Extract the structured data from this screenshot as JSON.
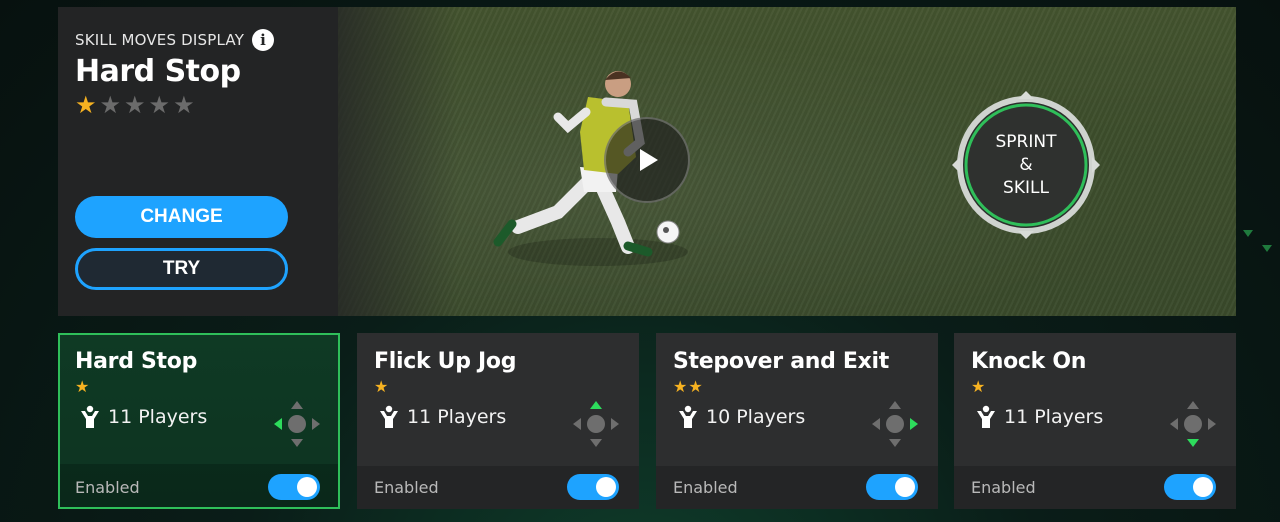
{
  "display": {
    "section_label": "SKILL MOVES DISPLAY",
    "title": "Hard Stop",
    "rating": 1,
    "max_rating": 5,
    "change_label": "CHANGE",
    "try_label": "TRY",
    "sprint_lines": [
      "SPRINT",
      "&",
      "SKILL"
    ]
  },
  "cards": [
    {
      "name": "Hard Stop",
      "stars": "★",
      "players": "11 Players",
      "direction": "left",
      "status": "Enabled",
      "enabled": true,
      "selected": true
    },
    {
      "name": "Flick Up Jog",
      "stars": "★",
      "players": "11 Players",
      "direction": "up",
      "status": "Enabled",
      "enabled": true,
      "selected": false
    },
    {
      "name": "Stepover and Exit",
      "stars": "★★",
      "players": "10 Players",
      "direction": "right",
      "status": "Enabled",
      "enabled": true,
      "selected": false
    },
    {
      "name": "Knock On",
      "stars": "★",
      "players": "11 Players",
      "direction": "down",
      "status": "Enabled",
      "enabled": true,
      "selected": false
    }
  ],
  "colors": {
    "accent_blue": "#1ea3ff",
    "selected_green": "#2fbf5a",
    "star_gold": "#f6b221",
    "direction_green": "#2ddc5c"
  }
}
